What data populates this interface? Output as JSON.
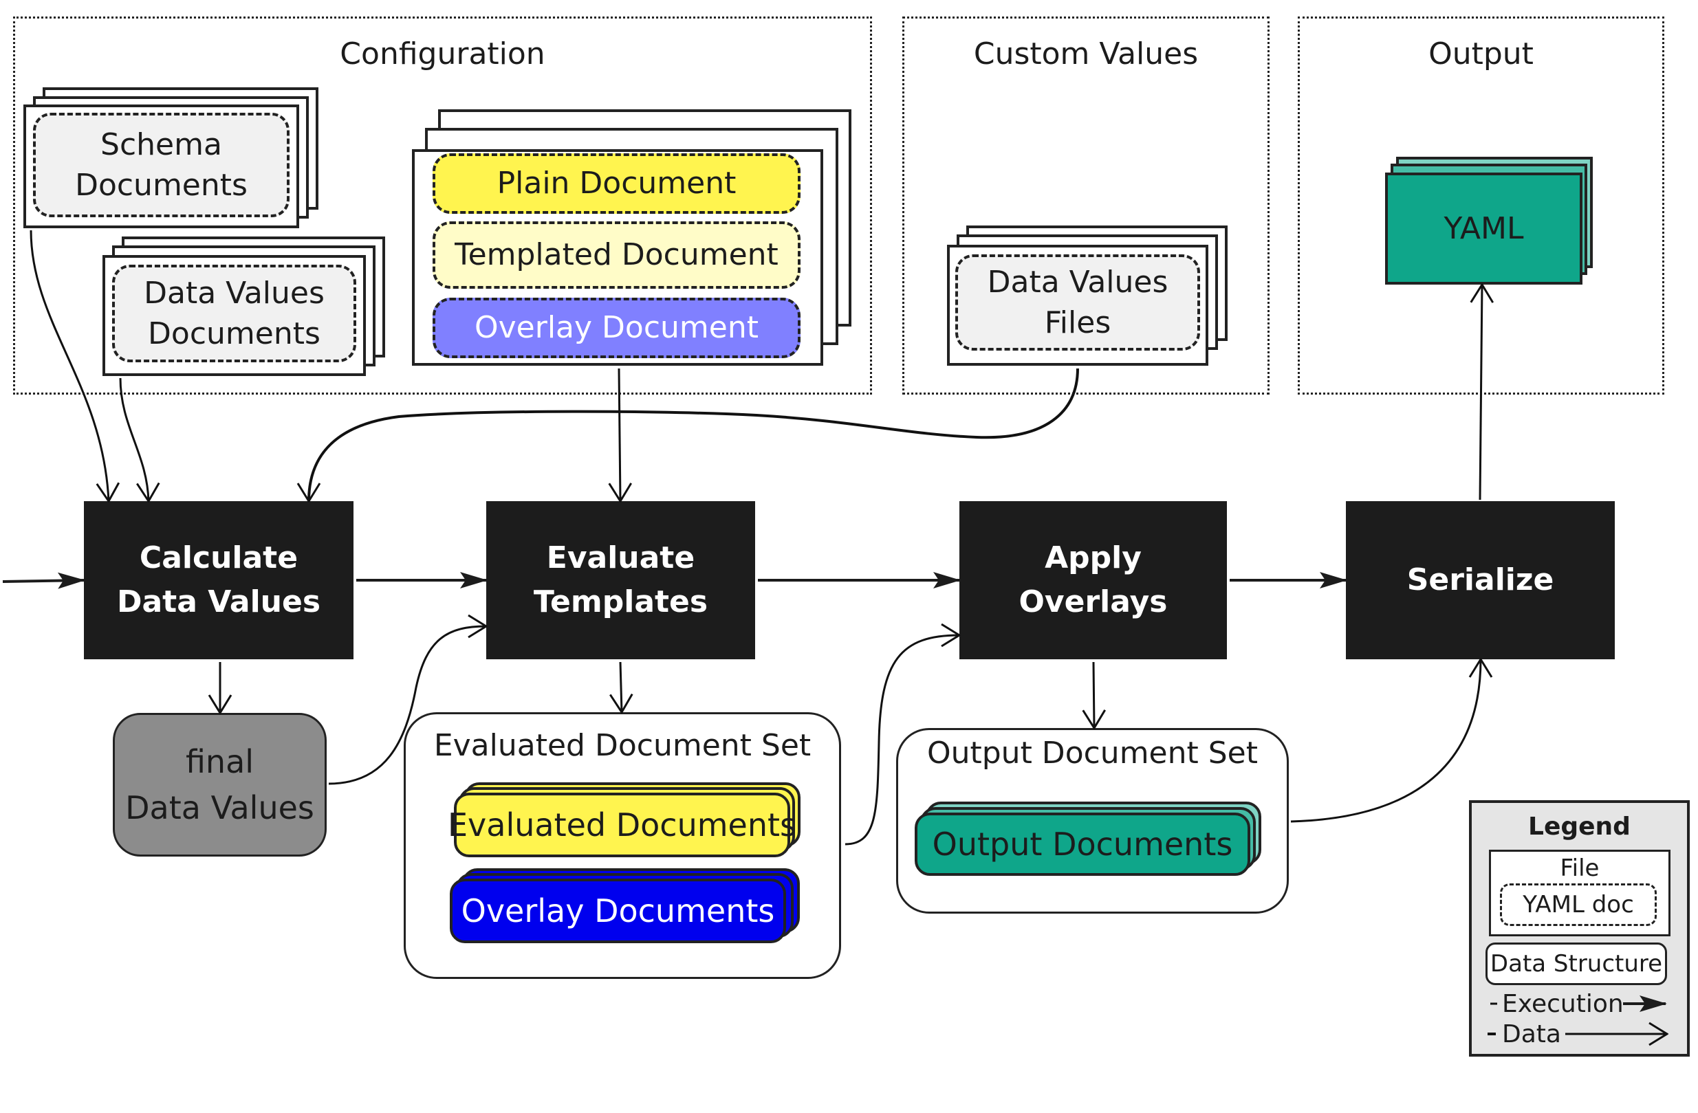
{
  "groups": {
    "configuration": {
      "title": "Configuration"
    },
    "custom_values": {
      "title": "Custom Values"
    },
    "output": {
      "title": "Output"
    }
  },
  "configuration": {
    "schema_documents": {
      "line1": "Schema",
      "line2": "Documents"
    },
    "data_values_documents": {
      "line1": "Data Values",
      "line2": "Documents"
    },
    "template_file": {
      "plain": "Plain Document",
      "templated": "Templated Document",
      "overlay": "Overlay Document"
    }
  },
  "custom_values": {
    "data_values_files": {
      "line1": "Data Values",
      "line2": "Files"
    }
  },
  "output": {
    "yaml": "YAML"
  },
  "process_steps": [
    {
      "line1": "Calculate",
      "line2": "Data Values"
    },
    {
      "line1": "Evaluate",
      "line2": "Templates"
    },
    {
      "line1": "Apply",
      "line2": "Overlays"
    },
    {
      "line1": "Serialize",
      "line2": ""
    }
  ],
  "data_structures": {
    "final_data_values": {
      "line1": "final",
      "line2": "Data Values"
    },
    "evaluated_document_set": {
      "title": "Evaluated Document Set",
      "evaluated_documents": "Evaluated Documents",
      "overlay_documents": "Overlay Documents"
    },
    "output_document_set": {
      "title": "Output Document Set",
      "output_documents": "Output Documents"
    }
  },
  "legend": {
    "title": "Legend",
    "file": "File",
    "yaml_doc": "YAML doc",
    "data_structure": "Data Structure",
    "execution": "Execution",
    "data": "Data"
  },
  "colors": {
    "process": "#1c1c1c",
    "plain_document": "#fff44f",
    "templated_document": "#fffcc8",
    "overlay_document": "#8080ff",
    "evaluated_documents": "#fff44f",
    "overlay_documents": "#0000ee",
    "output_teal": "#0fa68a",
    "final_data_values": "#8c8c8c",
    "yaml_doc_fill": "#f1f1f1",
    "legend_fill": "#e5e5e5"
  }
}
